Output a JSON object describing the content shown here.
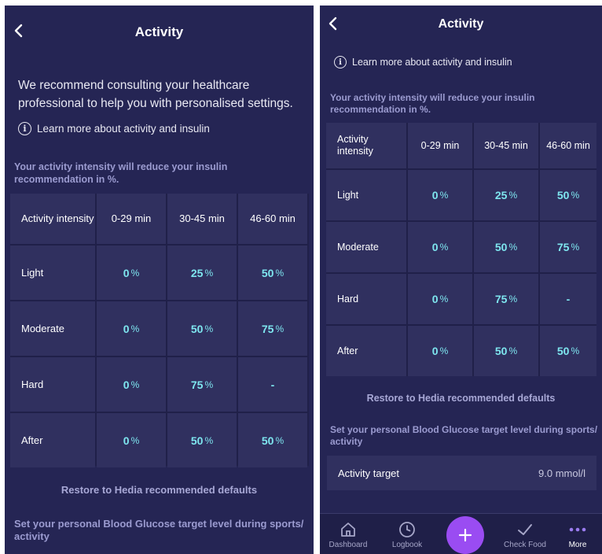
{
  "header": {
    "title": "Activity"
  },
  "intro": {
    "text": "We recommend consulting your healthcare professional to help you with personalised settings."
  },
  "info_link": {
    "label": "Learn more about activity and insulin"
  },
  "intensity_note": "Your activity intensity will reduce your insulin recommendation in %.",
  "table": {
    "headers": [
      "Activity intensity",
      "0-29 min",
      "30-45 min",
      "46-60 min"
    ],
    "rows": [
      {
        "label": "Light",
        "values": [
          "0",
          "25",
          "50"
        ]
      },
      {
        "label": "Moderate",
        "values": [
          "0",
          "50",
          "75"
        ]
      },
      {
        "label": "Hard",
        "values": [
          "0",
          "75",
          "-"
        ]
      },
      {
        "label": "After",
        "values": [
          "0",
          "50",
          "50"
        ]
      }
    ],
    "percent_symbol": "%"
  },
  "restore_label": "Restore to Hedia recommended defaults",
  "target_note": "Set your personal Blood Glucose target level during sports/ activity",
  "activity_target": {
    "label": "Activity target",
    "value": "9.0 mmol/l"
  },
  "tabs": [
    {
      "label": "Dashboard",
      "icon": "home-icon"
    },
    {
      "label": "Logbook",
      "icon": "clock-icon"
    },
    {
      "label": "",
      "icon": "plus-icon"
    },
    {
      "label": "Check Food",
      "icon": "check-icon"
    },
    {
      "label": "More",
      "icon": "more-dots-icon",
      "active": true
    }
  ],
  "colors": {
    "background": "#252554",
    "cell": "#30305f",
    "accent_value": "#7ee6ef",
    "label_muted": "#9b9bd0",
    "fab": "#9a4cf2"
  }
}
